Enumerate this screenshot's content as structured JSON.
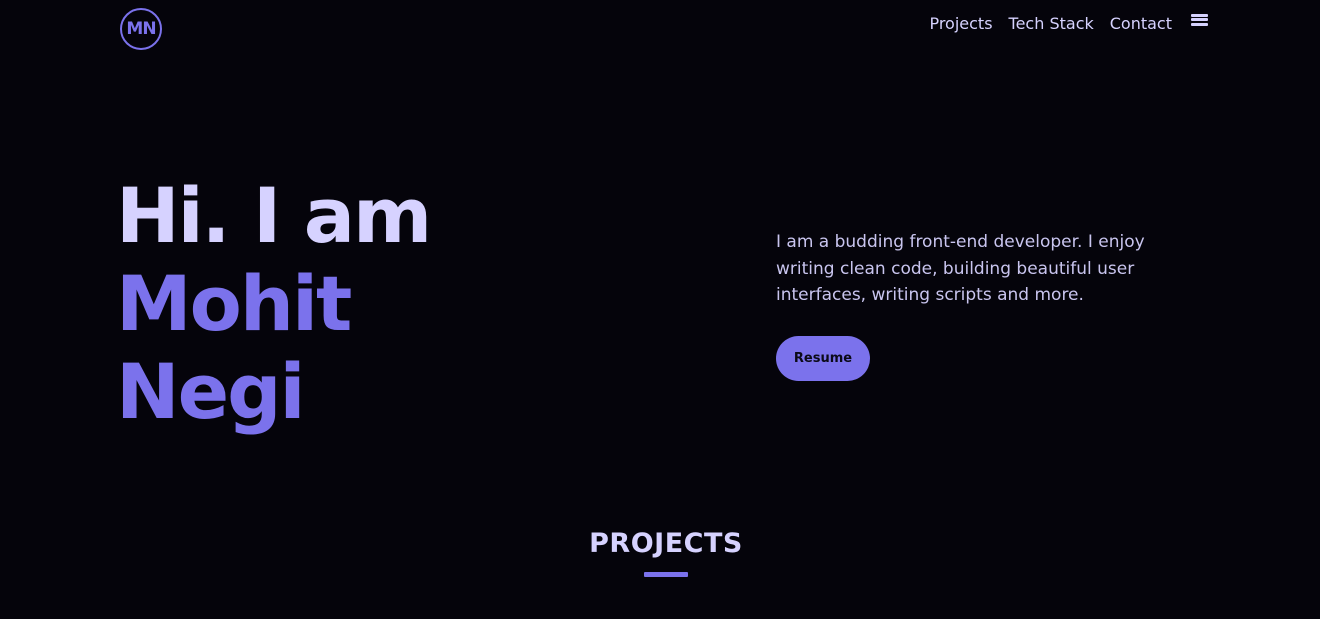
{
  "header": {
    "logo_text": "MN",
    "nav": [
      {
        "label": "Projects"
      },
      {
        "label": "Tech Stack"
      },
      {
        "label": "Contact"
      }
    ],
    "menu_icon": "hamburger-menu-icon"
  },
  "hero": {
    "greeting": "Hi. I am",
    "first_name": "Mohit",
    "last_name": "Negi",
    "intro": "I am a budding front-end developer. I enjoy writing clean code, building beautiful user interfaces, writing scripts and more.",
    "resume_label": "Resume"
  },
  "projects": {
    "title": "PROJECTS"
  },
  "colors": {
    "background": "#05040b",
    "accent": "#7b72ec",
    "light_text": "#d6d2ff"
  }
}
